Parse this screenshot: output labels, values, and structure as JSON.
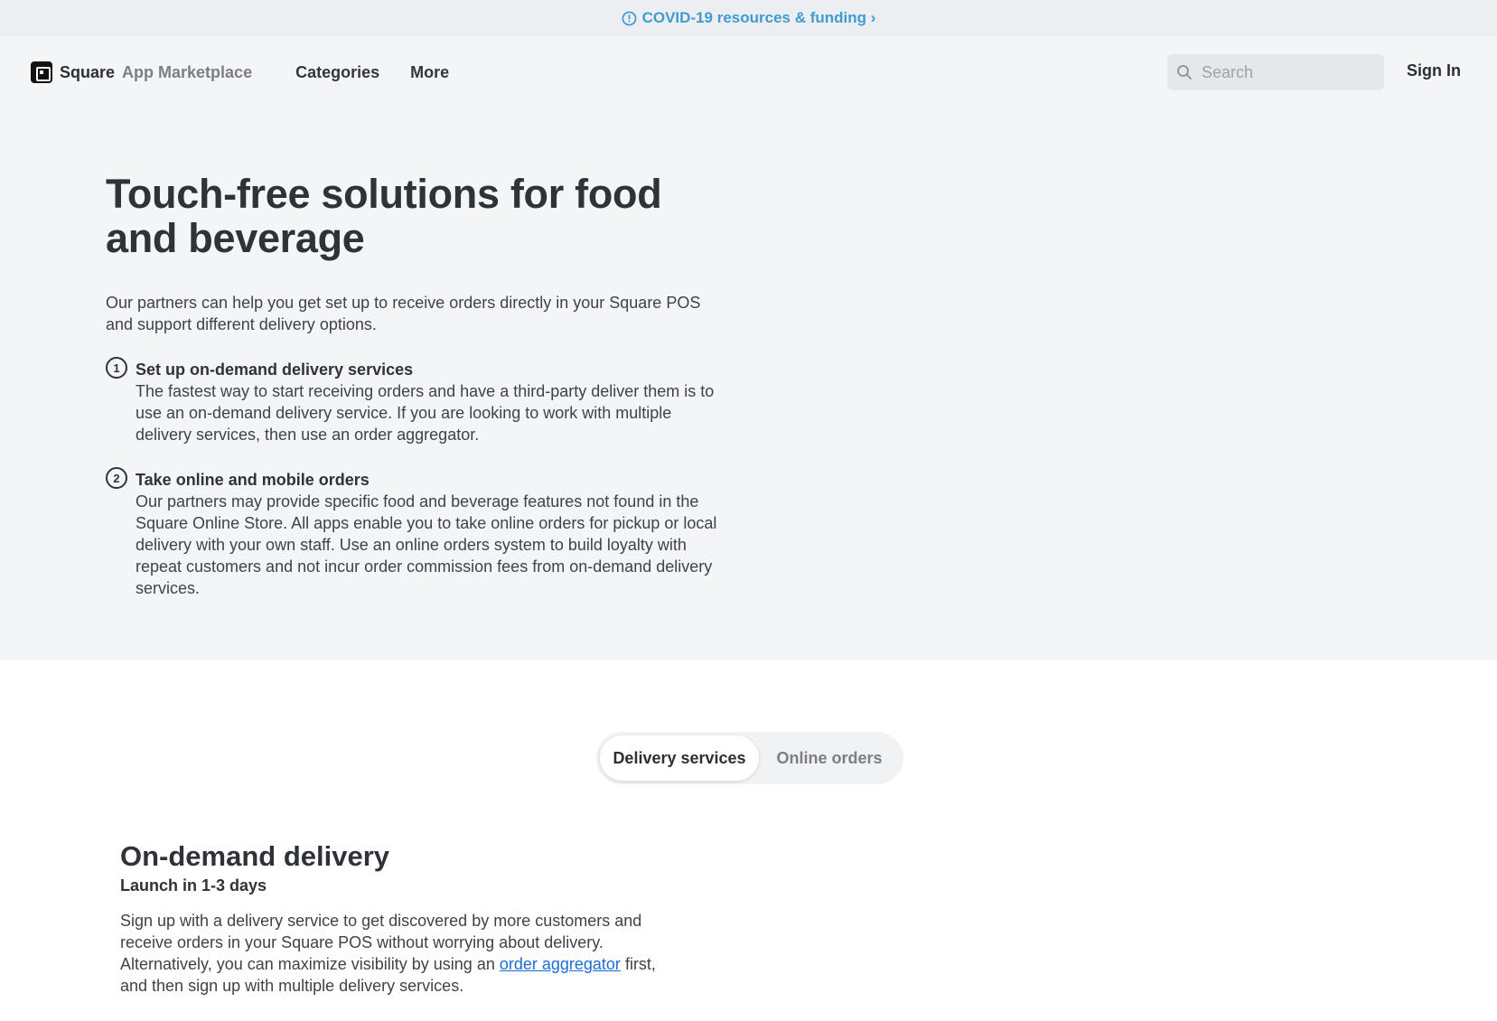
{
  "banner": {
    "text": "COVID-19 resources & funding ›",
    "icon": "info-circle-icon",
    "color": "#3f9bd0"
  },
  "nav": {
    "logo_brand": "Square",
    "logo_product": "App Marketplace",
    "links": [
      "Categories",
      "More"
    ],
    "search_placeholder": "Search",
    "sign_in": "Sign In"
  },
  "hero": {
    "title": "Touch-free solutions for food and beverage",
    "description": "Our partners can help you get set up to receive orders directly in your Square POS and support different delivery options.",
    "steps": [
      {
        "number": "1",
        "title": "Set up on-demand delivery services",
        "text": "The fastest way to start receiving orders and have a third-party deliver them is to use an on-demand delivery service. If you are looking to work with multiple delivery services, then use an order aggregator."
      },
      {
        "number": "2",
        "title": "Take online and mobile orders",
        "text": "Our partners may provide specific food and beverage features not found in the Square Online Store. All apps enable you to take online orders for pickup or local delivery with your own staff. Use an online orders system to build loyalty with repeat customers and not incur order commission fees from on-demand delivery services."
      }
    ]
  },
  "tabs": {
    "active": "Delivery services",
    "inactive": "Online orders"
  },
  "section": {
    "title": "On-demand delivery",
    "subtitle": "Launch in 1-3 days",
    "text_before": "Sign up with a delivery service to get discovered by more customers and receive orders in your Square POS without worrying about delivery. Alternatively, you can maximize visibility by using an ",
    "link": "order aggregator",
    "text_after": " first, and then sign up with multiple delivery services."
  }
}
